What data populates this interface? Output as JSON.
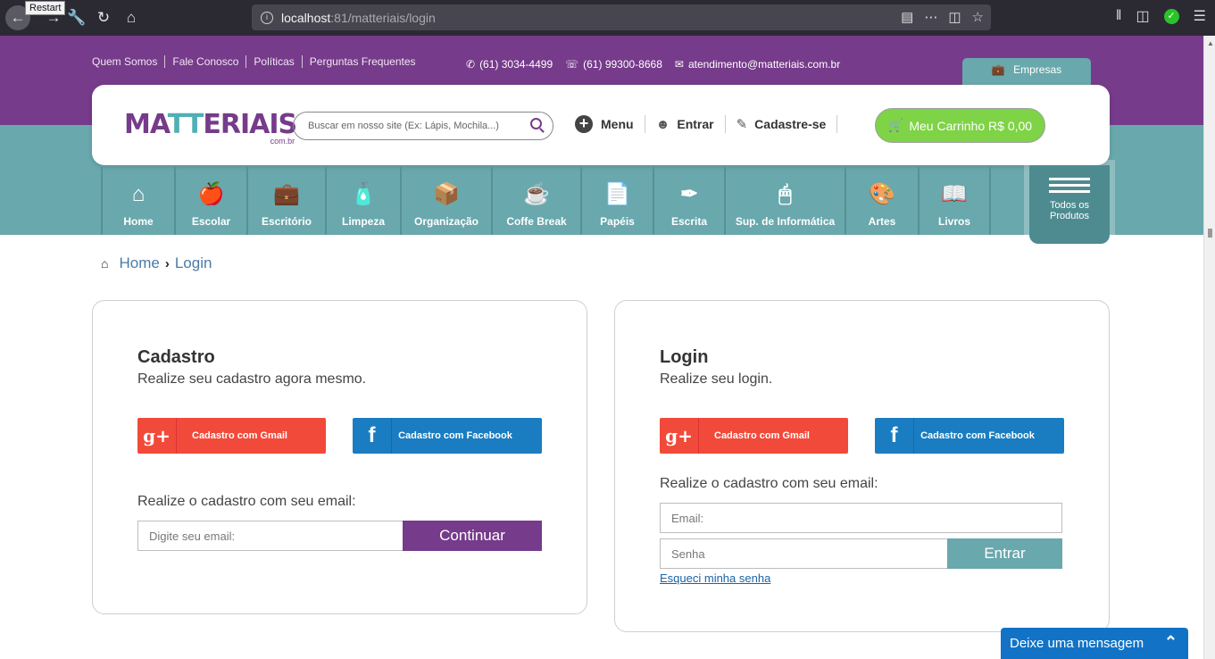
{
  "browser": {
    "tooltip": "Restart",
    "url_host": "localhost",
    "url_rest": ":81/matteriais/login"
  },
  "top_links": [
    "Quem Somos",
    "Fale Conosco",
    "Políticas",
    "Perguntas Frequentes"
  ],
  "contacts": {
    "phone": "(61) 3034-4499",
    "whatsapp": "(61) 99300-8668",
    "email": "atendimento@matteriais.com.br"
  },
  "empresas_tab": "Empresas",
  "logo": {
    "part1": "MA",
    "part2": "TT",
    "part3": "ERIAIS",
    "sub": "com.br"
  },
  "search": {
    "placeholder": "Buscar em nosso site (Ex: Lápis, Mochila...)"
  },
  "header_actions": {
    "menu": "Menu",
    "login": "Entrar",
    "register": "Cadastre-se"
  },
  "cart": {
    "label": "Meu Carrinho R$ 0,00"
  },
  "categories": [
    {
      "label": "Home",
      "icon": "house-icon"
    },
    {
      "label": "Escolar",
      "icon": "apple-books-icon"
    },
    {
      "label": "Escritório",
      "icon": "briefcase-icon"
    },
    {
      "label": "Limpeza",
      "icon": "spray-bottle-icon"
    },
    {
      "label": "Organização",
      "icon": "box-icon"
    },
    {
      "label": "Coffe Break",
      "icon": "coffee-cup-icon"
    },
    {
      "label": "Papéis",
      "icon": "paper-stack-icon"
    },
    {
      "label": "Escrita",
      "icon": "pen-icon"
    },
    {
      "label": "Sup. de Informática",
      "icon": "mouse-icon"
    },
    {
      "label": "Artes",
      "icon": "palette-icon"
    },
    {
      "label": "Livros",
      "icon": "book-icon"
    }
  ],
  "todos_produtos": {
    "line1": "Todos os",
    "line2": "Produtos"
  },
  "breadcrumb": {
    "home": "Home",
    "current": "Login"
  },
  "cadastro": {
    "title": "Cadastro",
    "subtitle": "Realize seu cadastro agora mesmo.",
    "gmail_label": "Cadastro com Gmail",
    "facebook_label": "Cadastro com Facebook",
    "email_label": "Realize o cadastro com seu email:",
    "email_placeholder": "Digite seu email:",
    "submit_label": "Continuar"
  },
  "login": {
    "title": "Login",
    "subtitle": "Realize seu login.",
    "gmail_label": "Cadastro com Gmail",
    "facebook_label": "Cadastro com Facebook",
    "email_label": "Realize o cadastro com seu email:",
    "email_placeholder": "Email:",
    "password_placeholder": "Senha",
    "submit_label": "Entrar",
    "forgot_label": "Esqueci minha senha"
  },
  "chat": {
    "label": "Deixe uma mensagem"
  },
  "colors": {
    "purple": "#763b8a",
    "teal": "#69a8ad",
    "green": "#7ed346",
    "gmail_red": "#f24a3a",
    "facebook_blue": "#1a7dc1",
    "chat_blue": "#1273c6"
  }
}
